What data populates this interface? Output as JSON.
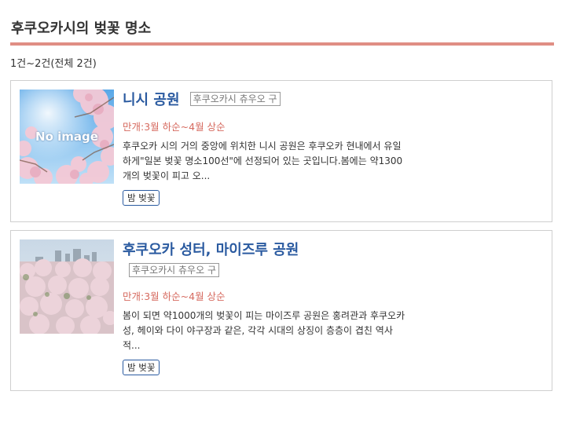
{
  "page": {
    "title": "후쿠오카시의 벚꽃 명소",
    "result_count": "1건~2건(전체 2건)"
  },
  "colors": {
    "accent_rule": "#e08e84",
    "link_blue": "#2a5aa0",
    "bloom_red": "#d66a5f"
  },
  "spots": [
    {
      "name": "니시 공원",
      "ward": "후쿠오카시 츄우오 구",
      "bloom": "만개:3월 하순~4월 상순",
      "description": "후쿠오카 시의 거의 중앙에 위치한 니시 공원은 후쿠오카 현내에서 유일하게\"일본 벚꽃 명소100선\"에 선정되어 있는 곳입니다.봄에는 약1300개의 벚꽃이 피고 오...",
      "tag": "밤 벚꽃",
      "image_text": "No image"
    },
    {
      "name": "후쿠오카 성터, 마이즈루 공원",
      "ward": "후쿠오카시 츄우오 구",
      "bloom": "만개:3월 하순~4월 상순",
      "description": "봄이 되면 약1000개의 벚꽃이 피는 마이즈루 공원은 홍려관과 후쿠오카 성, 헤이와 다이 야구장과 같은, 각각 시대의 상징이 층층이 겹친 역사적...",
      "tag": "밤 벚꽃"
    }
  ]
}
